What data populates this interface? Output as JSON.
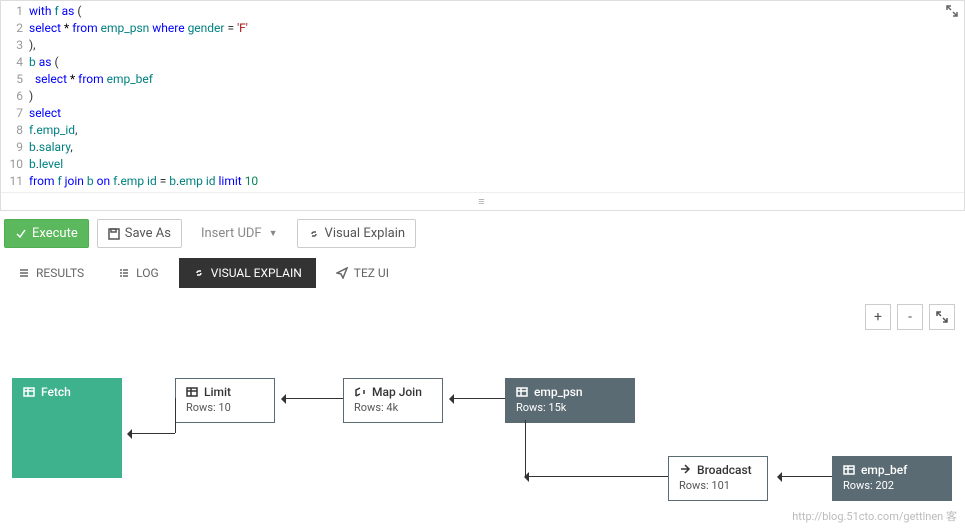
{
  "editor": {
    "lines": [
      "with f as (",
      "select * from emp_psn where gender = 'F'",
      "),",
      "b as (",
      "  select * from emp_bef",
      ")",
      "select",
      "f.emp_id,",
      "b.salary,",
      "b.level",
      "from f join b on f.emp id = b.emp id limit 10"
    ]
  },
  "toolbar": {
    "execute": "Execute",
    "save_as": "Save As",
    "insert_udf": "Insert UDF",
    "visual_explain": "Visual Explain"
  },
  "tabs": {
    "results": "RESULTS",
    "log": "LOG",
    "visual_explain": "VISUAL EXPLAIN",
    "tez_ui": "TEZ UI",
    "active": "visual_explain"
  },
  "zoom": {
    "in": "+",
    "out": "-",
    "fit": "⤢"
  },
  "plan": {
    "fetch": {
      "label": "Fetch"
    },
    "limit": {
      "label": "Limit",
      "rows": "Rows: 10"
    },
    "mapjoin": {
      "label": "Map Join",
      "rows": "Rows: 4k"
    },
    "emp_psn": {
      "label": "emp_psn",
      "rows": "Rows: 15k"
    },
    "broadcast": {
      "label": "Broadcast",
      "rows": "Rows: 101"
    },
    "emp_bef": {
      "label": "emp_bef",
      "rows": "Rows: 202"
    }
  },
  "watermark": "http://blog.51cto.com/gettlnen 客"
}
